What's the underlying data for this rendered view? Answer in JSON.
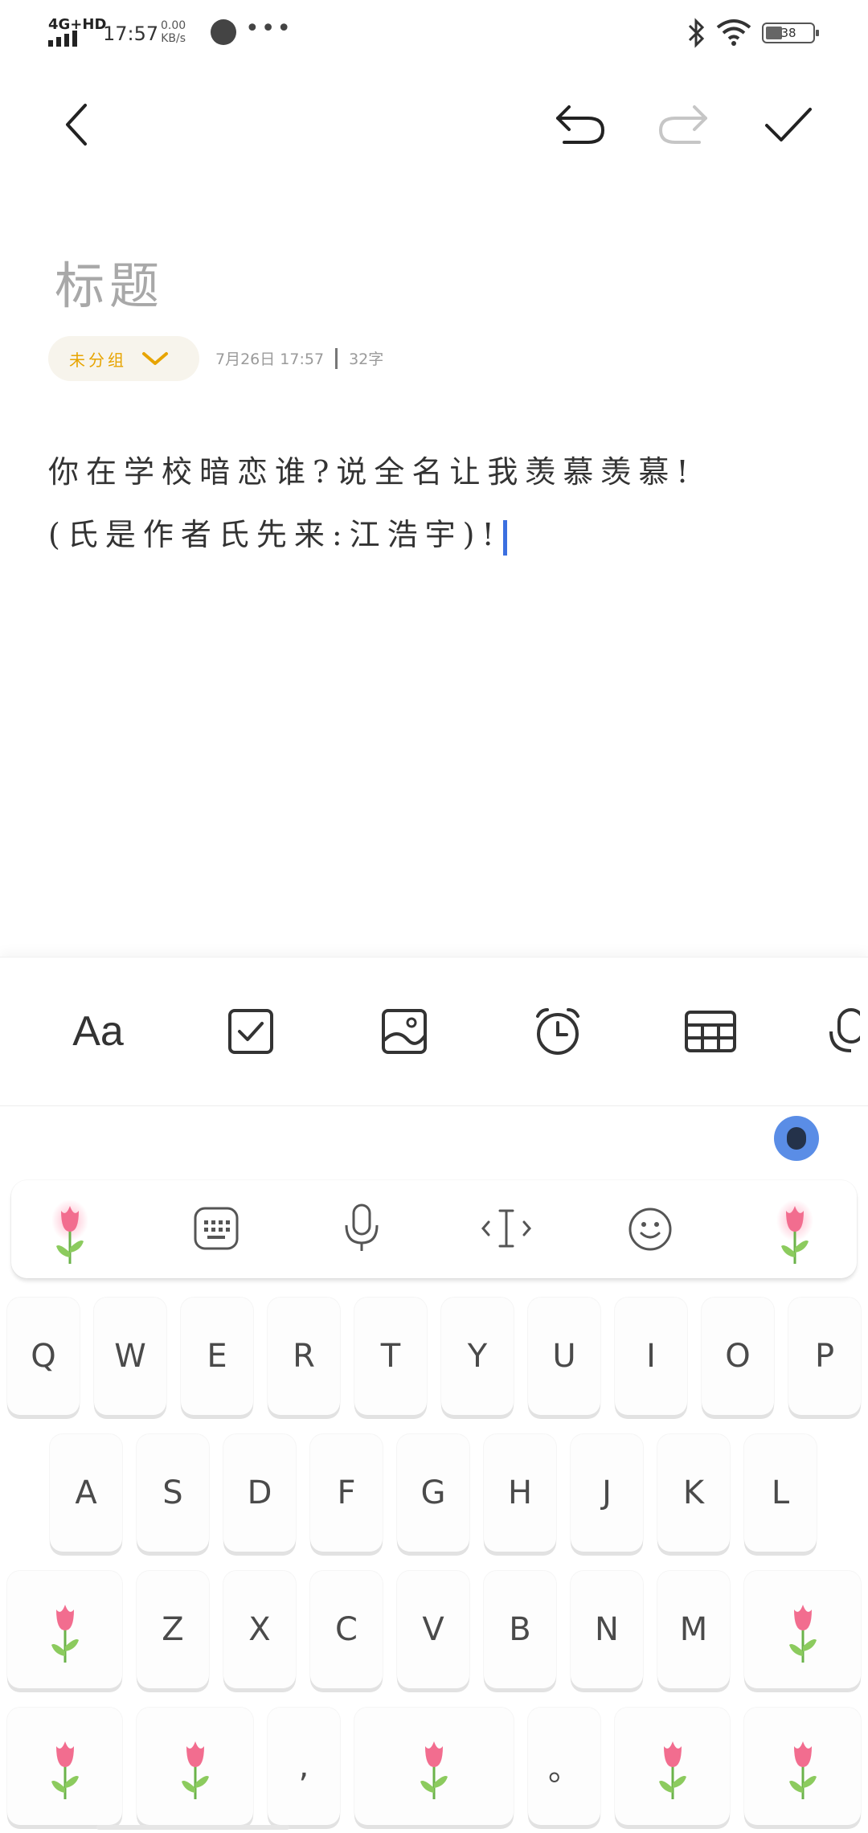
{
  "status_bar": {
    "network": "4G+HD",
    "time": "17:57",
    "speed_value": "0.00",
    "speed_unit": "KB/s",
    "dots": "•••",
    "battery": "38"
  },
  "toolbar": {
    "back": "back-icon",
    "undo": "undo-icon",
    "redo": "redo-icon",
    "done": "check-icon"
  },
  "note": {
    "title_placeholder": "标题",
    "group": "未分组",
    "date": "7月26日 17:57",
    "word_count": "32字",
    "line1": "你在学校暗恋谁?说全名让我羡慕羡慕!",
    "line2": "(氏是作者氏先来:江浩宇)!"
  },
  "format_toolbar": {
    "text_style": "Aa",
    "items": [
      "checkbox-icon",
      "image-icon",
      "alarm-icon",
      "table-icon",
      "mic-icon"
    ]
  },
  "keyboard": {
    "candidate_icons": [
      "tulip-icon",
      "keyboard-icon",
      "mic-icon",
      "cursor-icon",
      "emoji-icon",
      "tulip-icon"
    ],
    "row1": [
      "Q",
      "W",
      "E",
      "R",
      "T",
      "Y",
      "U",
      "I",
      "O",
      "P"
    ],
    "row2": [
      "A",
      "S",
      "D",
      "F",
      "G",
      "H",
      "J",
      "K",
      "L"
    ],
    "row3": [
      "Z",
      "X",
      "C",
      "V",
      "B",
      "N",
      "M"
    ],
    "comma": ",",
    "period": "。"
  },
  "colors": {
    "accent": "#e7a400",
    "cursor": "#3b6fe0",
    "tulip": "#f26d8f"
  }
}
